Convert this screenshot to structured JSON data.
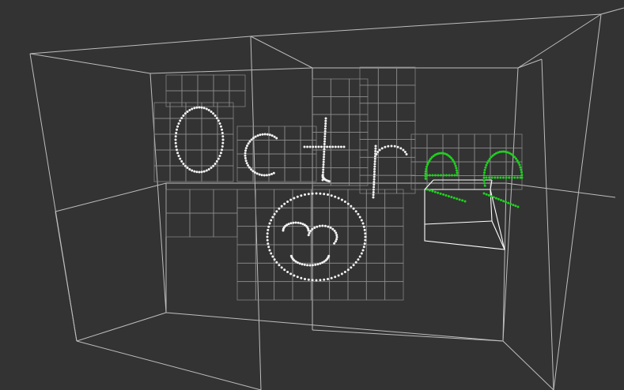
{
  "viewer": {
    "background_color": "#333333",
    "wireframe_color": "#bdbdbd",
    "point_color": "#f2f2f2",
    "selected_point_color": "#1fd11f",
    "selection_box_color": "#ffffff"
  },
  "scene": {
    "drawing_glyphs": [
      "O",
      "c",
      "t",
      "r",
      "e",
      "e"
    ],
    "smiley": true,
    "selected_glyph_indices": [
      4,
      5
    ]
  }
}
